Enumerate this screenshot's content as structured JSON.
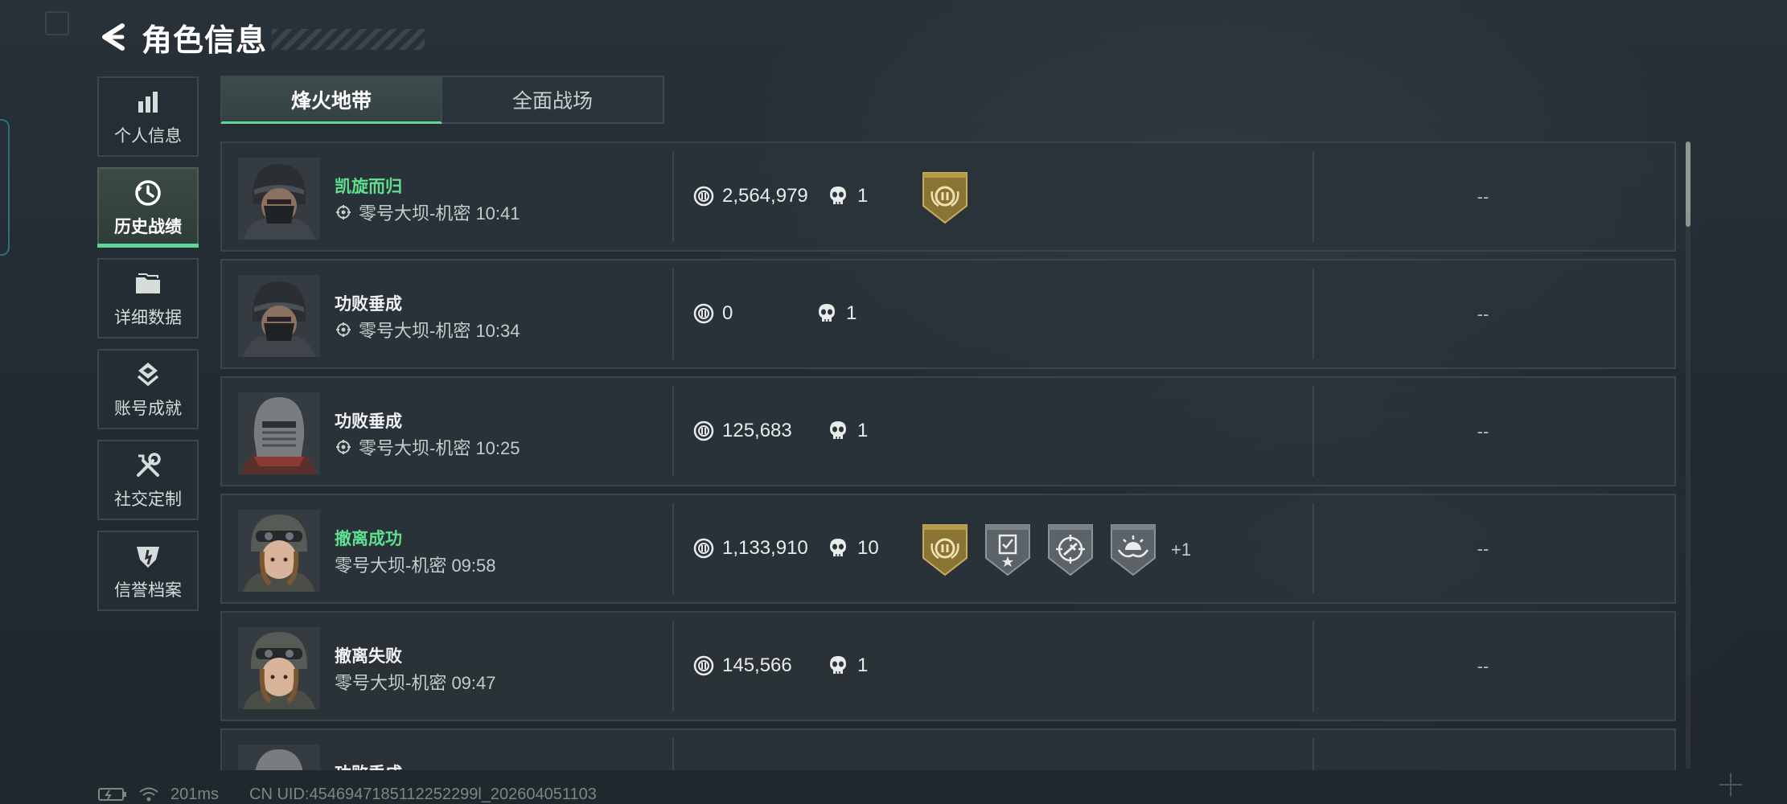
{
  "header": {
    "title": "角色信息"
  },
  "sidebar": {
    "items": [
      {
        "label": "个人信息",
        "icon": "bar-chart-icon",
        "active": false
      },
      {
        "label": "历史战绩",
        "icon": "clock-icon",
        "active": true
      },
      {
        "label": "详细数据",
        "icon": "folder-icon",
        "active": false
      },
      {
        "label": "账号成就",
        "icon": "achievement-icon",
        "active": false
      },
      {
        "label": "社交定制",
        "icon": "tools-icon",
        "active": false
      },
      {
        "label": "信誉档案",
        "icon": "shield-icon",
        "active": false
      }
    ]
  },
  "tabs": [
    {
      "label": "烽火地带",
      "active": true
    },
    {
      "label": "全面战场",
      "active": false
    }
  ],
  "records": [
    {
      "result": "凯旋而归",
      "result_color": "#5fe08f",
      "map_time": "零号大坝-机密 10:41",
      "show_map_icon": true,
      "value": "2,564,979",
      "kills": "1",
      "badges": [
        "gold-laurel-badge-icon"
      ],
      "extra": "",
      "tail": "--"
    },
    {
      "result": "功败垂成",
      "result_color": "#f1f4f2",
      "map_time": "零号大坝-机密 10:34",
      "show_map_icon": true,
      "value": "0",
      "kills": "1",
      "badges": [],
      "extra": "",
      "tail": "--"
    },
    {
      "result": "功败垂成",
      "result_color": "#f1f4f2",
      "map_time": "零号大坝-机密 10:25",
      "show_map_icon": true,
      "value": "125,683",
      "kills": "1",
      "badges": [],
      "extra": "",
      "tail": "--"
    },
    {
      "result": "撤离成功",
      "result_color": "#5fe08f",
      "map_time": "零号大坝-机密 09:58",
      "show_map_icon": false,
      "value": "1,133,910",
      "kills": "10",
      "badges": [
        "gold-laurel-badge-icon",
        "clipboard-star-badge-icon",
        "crosshair-badge-icon",
        "sunrise-badge-icon"
      ],
      "extra": "+1",
      "tail": "--"
    },
    {
      "result": "撤离失败",
      "result_color": "#f1f4f2",
      "map_time": "零号大坝-机密 09:47",
      "show_map_icon": false,
      "value": "145,566",
      "kills": "1",
      "badges": [],
      "extra": "",
      "tail": "--"
    },
    {
      "result": "功败垂成",
      "result_color": "#f1f4f2",
      "map_time": "",
      "show_map_icon": false,
      "value": "",
      "kills": "",
      "badges": [],
      "extra": "",
      "tail": ""
    }
  ],
  "footer": {
    "ping": "201ms",
    "uid": "CN UID:4546947185112252299l_202604051103"
  }
}
